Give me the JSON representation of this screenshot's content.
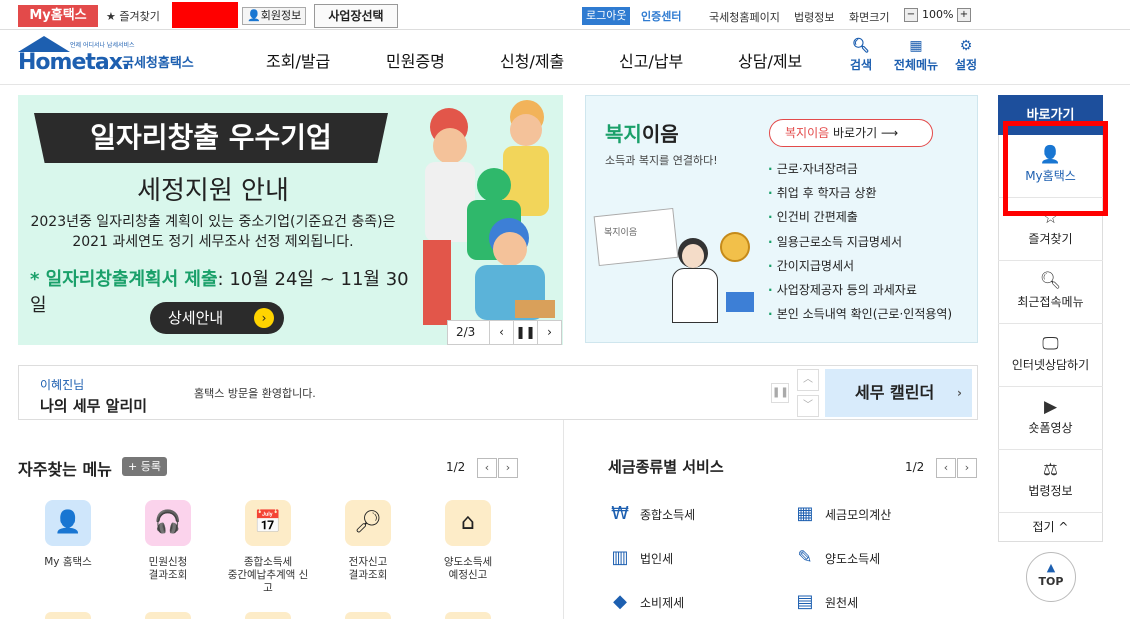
{
  "topbar": {
    "my_hometax": "My홈택스",
    "favorites": "★ 즐겨찾기",
    "member_info": "회원정보",
    "business_select": "사업장선택",
    "logout": "로그아웃",
    "cert_center": "인증센터",
    "links": [
      "국세청홈페이지",
      "법령정보",
      "화면크기"
    ],
    "zoom": "100%",
    "zoom_minus": "−",
    "zoom_plus": "+"
  },
  "header": {
    "logo_text": "Hometax.",
    "logo_sub": "국세청홈택스",
    "logo_small": "언제 어디서나 납세서비스",
    "nav": [
      "조회/발급",
      "민원증명",
      "신청/제출",
      "신고/납부",
      "상담/제보"
    ],
    "icons": [
      {
        "label": "검색",
        "icon": "search-icon"
      },
      {
        "label": "전체메뉴",
        "icon": "grid-icon"
      },
      {
        "label": "설정",
        "icon": "gear-icon"
      }
    ]
  },
  "banner": {
    "title": "일자리창출 우수기업",
    "subtitle": "세정지원 안내",
    "desc1": "2023년중 일자리창출 계획이 있는 중소기업(기준요건 충족)은",
    "desc2": "2021 과세연도 정기 세무조사 선정 제외됩니다.",
    "period_label": "* 일자리창출계획서 제출",
    "period_value": ": 10월 24일 ~ 11월 30일",
    "button": "상세안내",
    "page": "2/3"
  },
  "welfare": {
    "title_accent": "복지",
    "title_rest": "이음",
    "subtitle": "소득과 복지를 연결하다!",
    "button_accent": "복지이음",
    "button_rest": " 바로가기 ⟶",
    "items": [
      "근로·자녀장려금",
      "취업 후 학자금 상환",
      "인건비 간편제출",
      "일용근로소득 지급명세서",
      "간이지급명세서",
      "사업장제공자 등의 과세자료",
      "본인 소득내역 확인(근로·인적용역)"
    ],
    "illus_label": "복지이음"
  },
  "notice": {
    "name": "이혜진님",
    "title": "나의 세무 알리미",
    "message": "홈택스 방문을 환영합니다.",
    "calendar": "세무 캘린더"
  },
  "frequent": {
    "title": "자주찾는 메뉴",
    "register": "+ 등록",
    "page": "1/2",
    "items": [
      {
        "label": "My 홈택스",
        "icon": "user-icon",
        "color": "#cfe6fb"
      },
      {
        "label": "민원신청\n결과조회",
        "icon": "headset-icon",
        "color": "#fbd3ec"
      },
      {
        "label": "종합소득세\n중간예납추계액 신고",
        "icon": "calendar-icon",
        "color": "#fdecc8"
      },
      {
        "label": "전자신고\n결과조회",
        "icon": "search-doc-icon",
        "color": "#fdecc8"
      },
      {
        "label": "양도소득세\n예정신고",
        "icon": "house-icon",
        "color": "#fdecc8"
      }
    ]
  },
  "tax_services": {
    "title": "세금종류별 서비스",
    "page": "1/2",
    "items": [
      "종합소득세",
      "세금모의계산",
      "법인세",
      "양도소득세",
      "소비제세",
      "원천세"
    ]
  },
  "quick": {
    "header": "바로가기",
    "items": [
      {
        "label": "My홈택스",
        "icon": "user-icon"
      },
      {
        "label": "즐겨찾기",
        "icon": "star-icon"
      },
      {
        "label": "최근접속메뉴",
        "icon": "recent-icon"
      },
      {
        "label": "인터넷상담하기",
        "icon": "monitor-icon"
      },
      {
        "label": "숏폼영상",
        "icon": "play-icon"
      },
      {
        "label": "법령정보",
        "icon": "gavel-icon"
      }
    ],
    "fold": "접기 ^",
    "top": "TOP"
  }
}
